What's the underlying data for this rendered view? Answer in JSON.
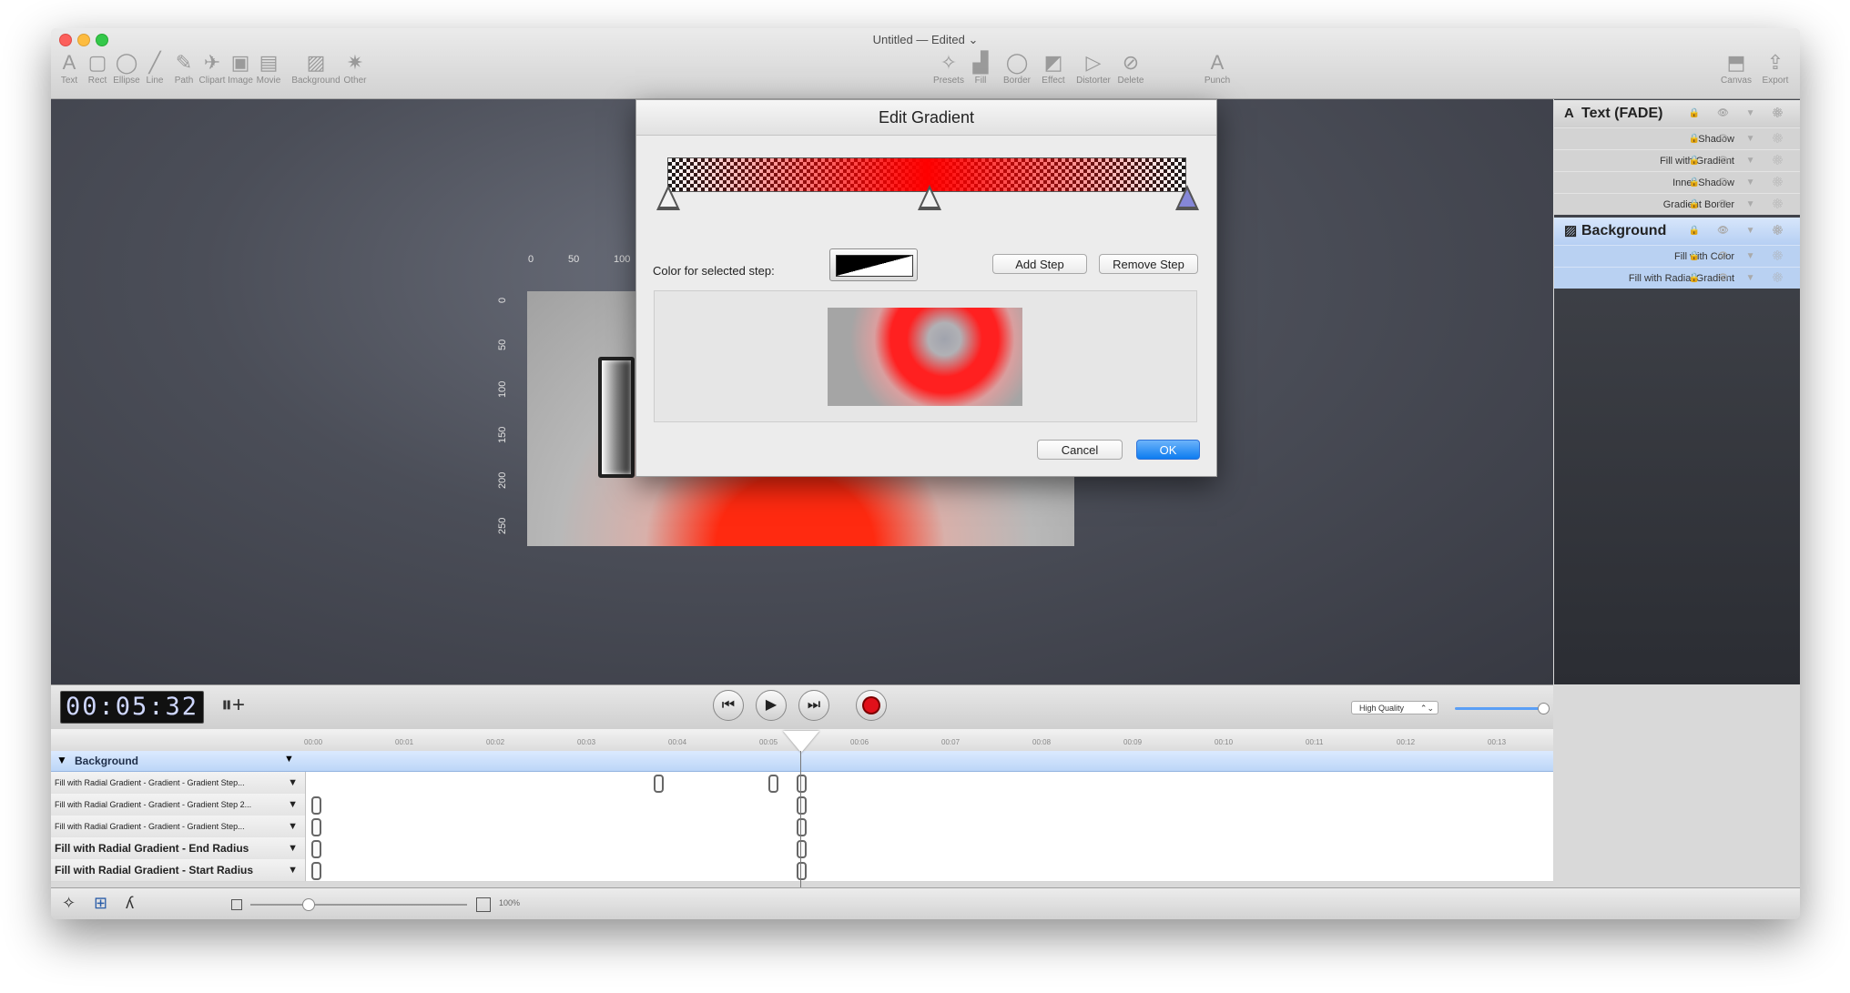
{
  "window": {
    "title": "Untitled",
    "edited": "— Edited",
    "edited_chevron": "⌄"
  },
  "toolbar": {
    "left": [
      {
        "label": "Text",
        "icon": "text-icon",
        "glyph": "A"
      },
      {
        "label": "Rect",
        "icon": "rect-icon",
        "glyph": "▢"
      },
      {
        "label": "Ellipse",
        "icon": "ellipse-icon",
        "glyph": "◯"
      },
      {
        "label": "Line",
        "icon": "line-icon",
        "glyph": "╱"
      },
      {
        "label": "Path",
        "icon": "path-icon",
        "glyph": "✎"
      },
      {
        "label": "Clipart",
        "icon": "clipart-icon",
        "glyph": "✈"
      },
      {
        "label": "Image",
        "icon": "image-icon",
        "glyph": "▣"
      },
      {
        "label": "Movie",
        "icon": "movie-icon",
        "glyph": "▤"
      },
      {
        "label": "Background",
        "icon": "background-icon",
        "glyph": "▨"
      },
      {
        "label": "Other",
        "icon": "other-icon",
        "glyph": "✷"
      }
    ],
    "center": [
      {
        "label": "Presets",
        "icon": "presets-icon",
        "glyph": "✧"
      },
      {
        "label": "Fill",
        "icon": "fill-icon",
        "glyph": "▟"
      },
      {
        "label": "Border",
        "icon": "border-icon",
        "glyph": "◯"
      },
      {
        "label": "Effect",
        "icon": "effect-icon",
        "glyph": "◩"
      },
      {
        "label": "Distorter",
        "icon": "distorter-icon",
        "glyph": "▷"
      },
      {
        "label": "Delete",
        "icon": "delete-icon",
        "glyph": "⊘"
      }
    ],
    "punch": {
      "label": "Punch",
      "icon": "punch-icon",
      "glyph": "A"
    },
    "right": [
      {
        "label": "Canvas",
        "icon": "canvas-icon",
        "glyph": "⬒"
      },
      {
        "label": "Export",
        "icon": "export-icon",
        "glyph": "⇪"
      }
    ]
  },
  "rulers": {
    "top": [
      "0",
      "50",
      "100"
    ],
    "left": [
      "0",
      "50",
      "100",
      "150",
      "200",
      "250"
    ]
  },
  "layers": {
    "text_layer": {
      "title": "Text (FADE)",
      "glyph": "A",
      "items": [
        "Shadow",
        "Fill with Gradient",
        "Inner Shadow",
        "Gradient Border"
      ]
    },
    "background_layer": {
      "title": "Background",
      "glyph": "▨",
      "items": [
        "Fill with Color",
        "Fill with Radial Gradient"
      ]
    },
    "row_icons": "🔒 👁 ▼ ⚙"
  },
  "transport": {
    "timecode": "00:05:32",
    "add_keyframe_glyph": "⏸+",
    "rewind_glyph": "⏮",
    "play_glyph": "▶",
    "forward_glyph": "⏭",
    "quality": "High Quality",
    "quality_chevron": "⌃⌄"
  },
  "timeline": {
    "ticks": [
      "00:00",
      "00:01",
      "00:02",
      "00:03",
      "00:04",
      "00:05",
      "00:06",
      "00:07",
      "00:08",
      "00:09",
      "00:10",
      "00:11",
      "00:12",
      "00:13"
    ],
    "group": "Background",
    "tracks": [
      {
        "label": "Fill with Radial Gradient - Gradient - Gradient Step...",
        "bold": false
      },
      {
        "label": "Fill with Radial Gradient - Gradient - Gradient Step 2...",
        "bold": false
      },
      {
        "label": "Fill with Radial Gradient - Gradient - Gradient Step...",
        "bold": false
      },
      {
        "label": "Fill with Radial Gradient - End Radius",
        "bold": true
      },
      {
        "label": "Fill with Radial Gradient - Start Radius",
        "bold": true
      }
    ],
    "arrow": "▼"
  },
  "bottom": {
    "zoom": "100%",
    "wand_glyph": "✧",
    "grid_glyph": "⊞",
    "snap_glyph": "ʎ"
  },
  "dialog": {
    "title": "Edit Gradient",
    "color_label": "Color for selected step:",
    "add_step": "Add Step",
    "remove_step": "Remove Step",
    "cancel": "Cancel",
    "ok": "OK"
  },
  "colors": {
    "accent": "#0d7cf0",
    "selection": "#bcd6f7",
    "record": "#e0101a"
  }
}
